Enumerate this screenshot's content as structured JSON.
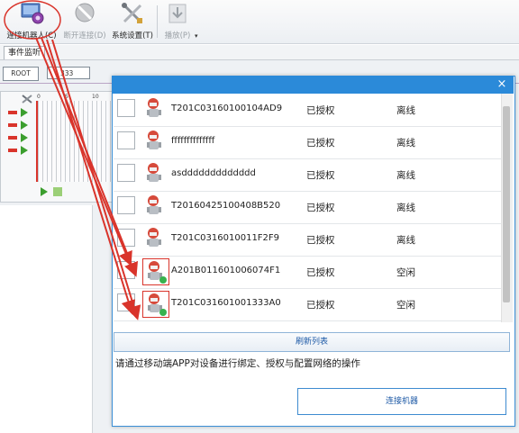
{
  "toolbar": {
    "connect_label": "连接机器人(C)",
    "disconnect_label": "断开连接(D)",
    "settings_label": "系统设置(T)",
    "play_label": "播放(P)"
  },
  "tabs": {
    "event_monitor": "事件监听"
  },
  "workspace": {
    "root_node": "ROOT",
    "child_node": "333",
    "ruler": [
      "0",
      "5",
      "10"
    ]
  },
  "dialog": {
    "close_glyph": "×",
    "robots": [
      {
        "name": "T201C03160100104AD9",
        "auth": "已授权",
        "status": "离线",
        "online": false
      },
      {
        "name": "ffffffffffffff",
        "auth": "已授权",
        "status": "离线",
        "online": false
      },
      {
        "name": "asddddddddddddd",
        "auth": "已授权",
        "status": "离线",
        "online": false
      },
      {
        "name": "T20160425100408B520",
        "auth": "已授权",
        "status": "离线",
        "online": false
      },
      {
        "name": "T201C0316010011F2F9",
        "auth": "已授权",
        "status": "离线",
        "online": false
      },
      {
        "name": "A201B011601006074F1",
        "auth": "已授权",
        "status": "空闲",
        "online": true
      },
      {
        "name": "T201C031601001333A0",
        "auth": "已授权",
        "status": "空闲",
        "online": true
      }
    ],
    "refresh_label": "刷新列表",
    "instructions": "请通过移动端APP对设备进行绑定、授权与配置网络的操作",
    "connect_label": "连接机器"
  },
  "colors": {
    "title_bar": "#2b8ad9",
    "annotation_red": "#d9342b",
    "online_dot": "#37b24d"
  }
}
